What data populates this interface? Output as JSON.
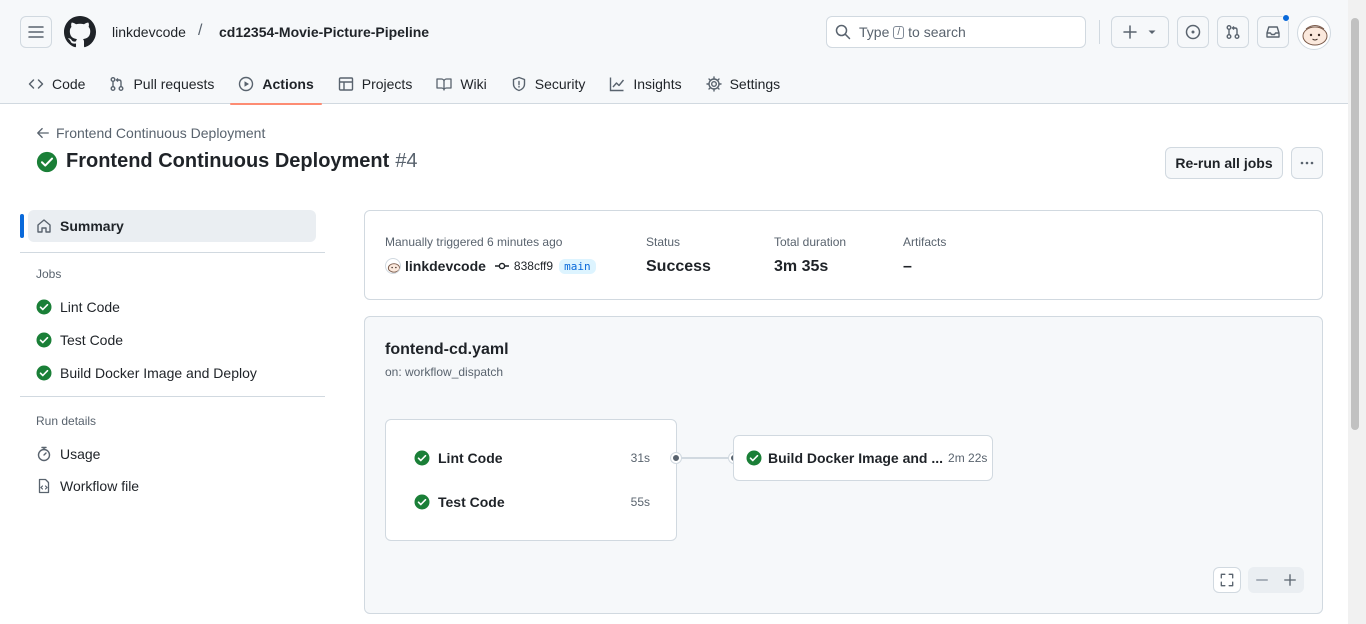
{
  "header": {
    "owner": "linkdevcode",
    "separator": "/",
    "repo": "cd12354-Movie-Picture-Pipeline",
    "search": {
      "prefix": "Type",
      "key": "/",
      "suffix": "to search"
    }
  },
  "tabs": [
    {
      "label": "Code",
      "icon": "code-icon"
    },
    {
      "label": "Pull requests",
      "icon": "git-pull-request-icon"
    },
    {
      "label": "Actions",
      "icon": "play-icon",
      "active": true
    },
    {
      "label": "Projects",
      "icon": "table-icon"
    },
    {
      "label": "Wiki",
      "icon": "book-icon"
    },
    {
      "label": "Security",
      "icon": "shield-icon"
    },
    {
      "label": "Insights",
      "icon": "graph-icon"
    },
    {
      "label": "Settings",
      "icon": "gear-icon"
    }
  ],
  "run": {
    "back_label": "Frontend Continuous Deployment",
    "title": "Frontend Continuous Deployment",
    "number": "#4",
    "rerun_label": "Re-run all jobs"
  },
  "sidebar": {
    "summary_label": "Summary",
    "jobs_heading": "Jobs",
    "jobs": [
      "Lint Code",
      "Test Code",
      "Build Docker Image and Deploy"
    ],
    "run_details_heading": "Run details",
    "usage_label": "Usage",
    "workflow_file_label": "Workflow file"
  },
  "summary": {
    "trigger_label": "Manually triggered 6 minutes ago",
    "actor": "linkdevcode",
    "sha": "838cff9",
    "branch": "main",
    "status_label": "Status",
    "status_value": "Success",
    "duration_label": "Total duration",
    "duration_value": "3m 35s",
    "artifacts_label": "Artifacts",
    "artifacts_value": "–"
  },
  "workflow": {
    "file": "fontend-cd.yaml",
    "trigger": "on: workflow_dispatch",
    "jobs": [
      {
        "name": "Lint Code",
        "duration": "31s"
      },
      {
        "name": "Test Code",
        "duration": "55s"
      }
    ],
    "deploy_job": {
      "name": "Build Docker Image and ...",
      "duration": "2m 22s"
    }
  },
  "colors": {
    "success": "#1a7f37",
    "accent": "#0969da",
    "tab_underline": "#fd8c73"
  }
}
